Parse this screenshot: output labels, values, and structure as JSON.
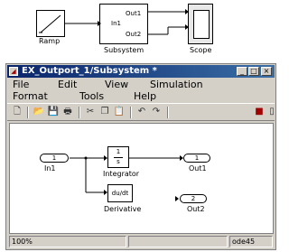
{
  "top_model": {
    "ramp_label": "Ramp",
    "subsystem_label": "Subsystem",
    "scope_label": "Scope",
    "subsystem_in_port": "In1",
    "subsystem_out_ports": [
      "Out1",
      "Out2"
    ]
  },
  "window": {
    "title": "EX_Outport_1/Subsystem *",
    "controls": [
      "_",
      "□",
      "×"
    ]
  },
  "menubar": {
    "row1": [
      "File",
      "Edit",
      "View",
      "Simulation"
    ],
    "row2": [
      "Format",
      "Tools",
      "Help"
    ]
  },
  "toolbar": {
    "icons": [
      "new-icon",
      "open-icon",
      "save-icon",
      "print-icon",
      "cut-icon",
      "copy-icon",
      "paste-icon",
      "undo-icon",
      "redo-icon",
      "library-icon",
      "debug-icon"
    ]
  },
  "diagram": {
    "in1_number": "1",
    "in1_label": "In1",
    "integrator_num": "1",
    "integrator_den": "s",
    "integrator_label": "Integrator",
    "out1_number": "1",
    "out1_label": "Out1",
    "derivative_symbol": "du/dt",
    "derivative_label": "Derivative",
    "out2_number": "2",
    "out2_label": "Out2"
  },
  "status": {
    "zoom": "100%",
    "solver": "ode45"
  },
  "colors": {
    "titlebar_start": "#0a246a",
    "titlebar_end": "#3a6ea5",
    "window_bg": "#d4d0c8"
  }
}
